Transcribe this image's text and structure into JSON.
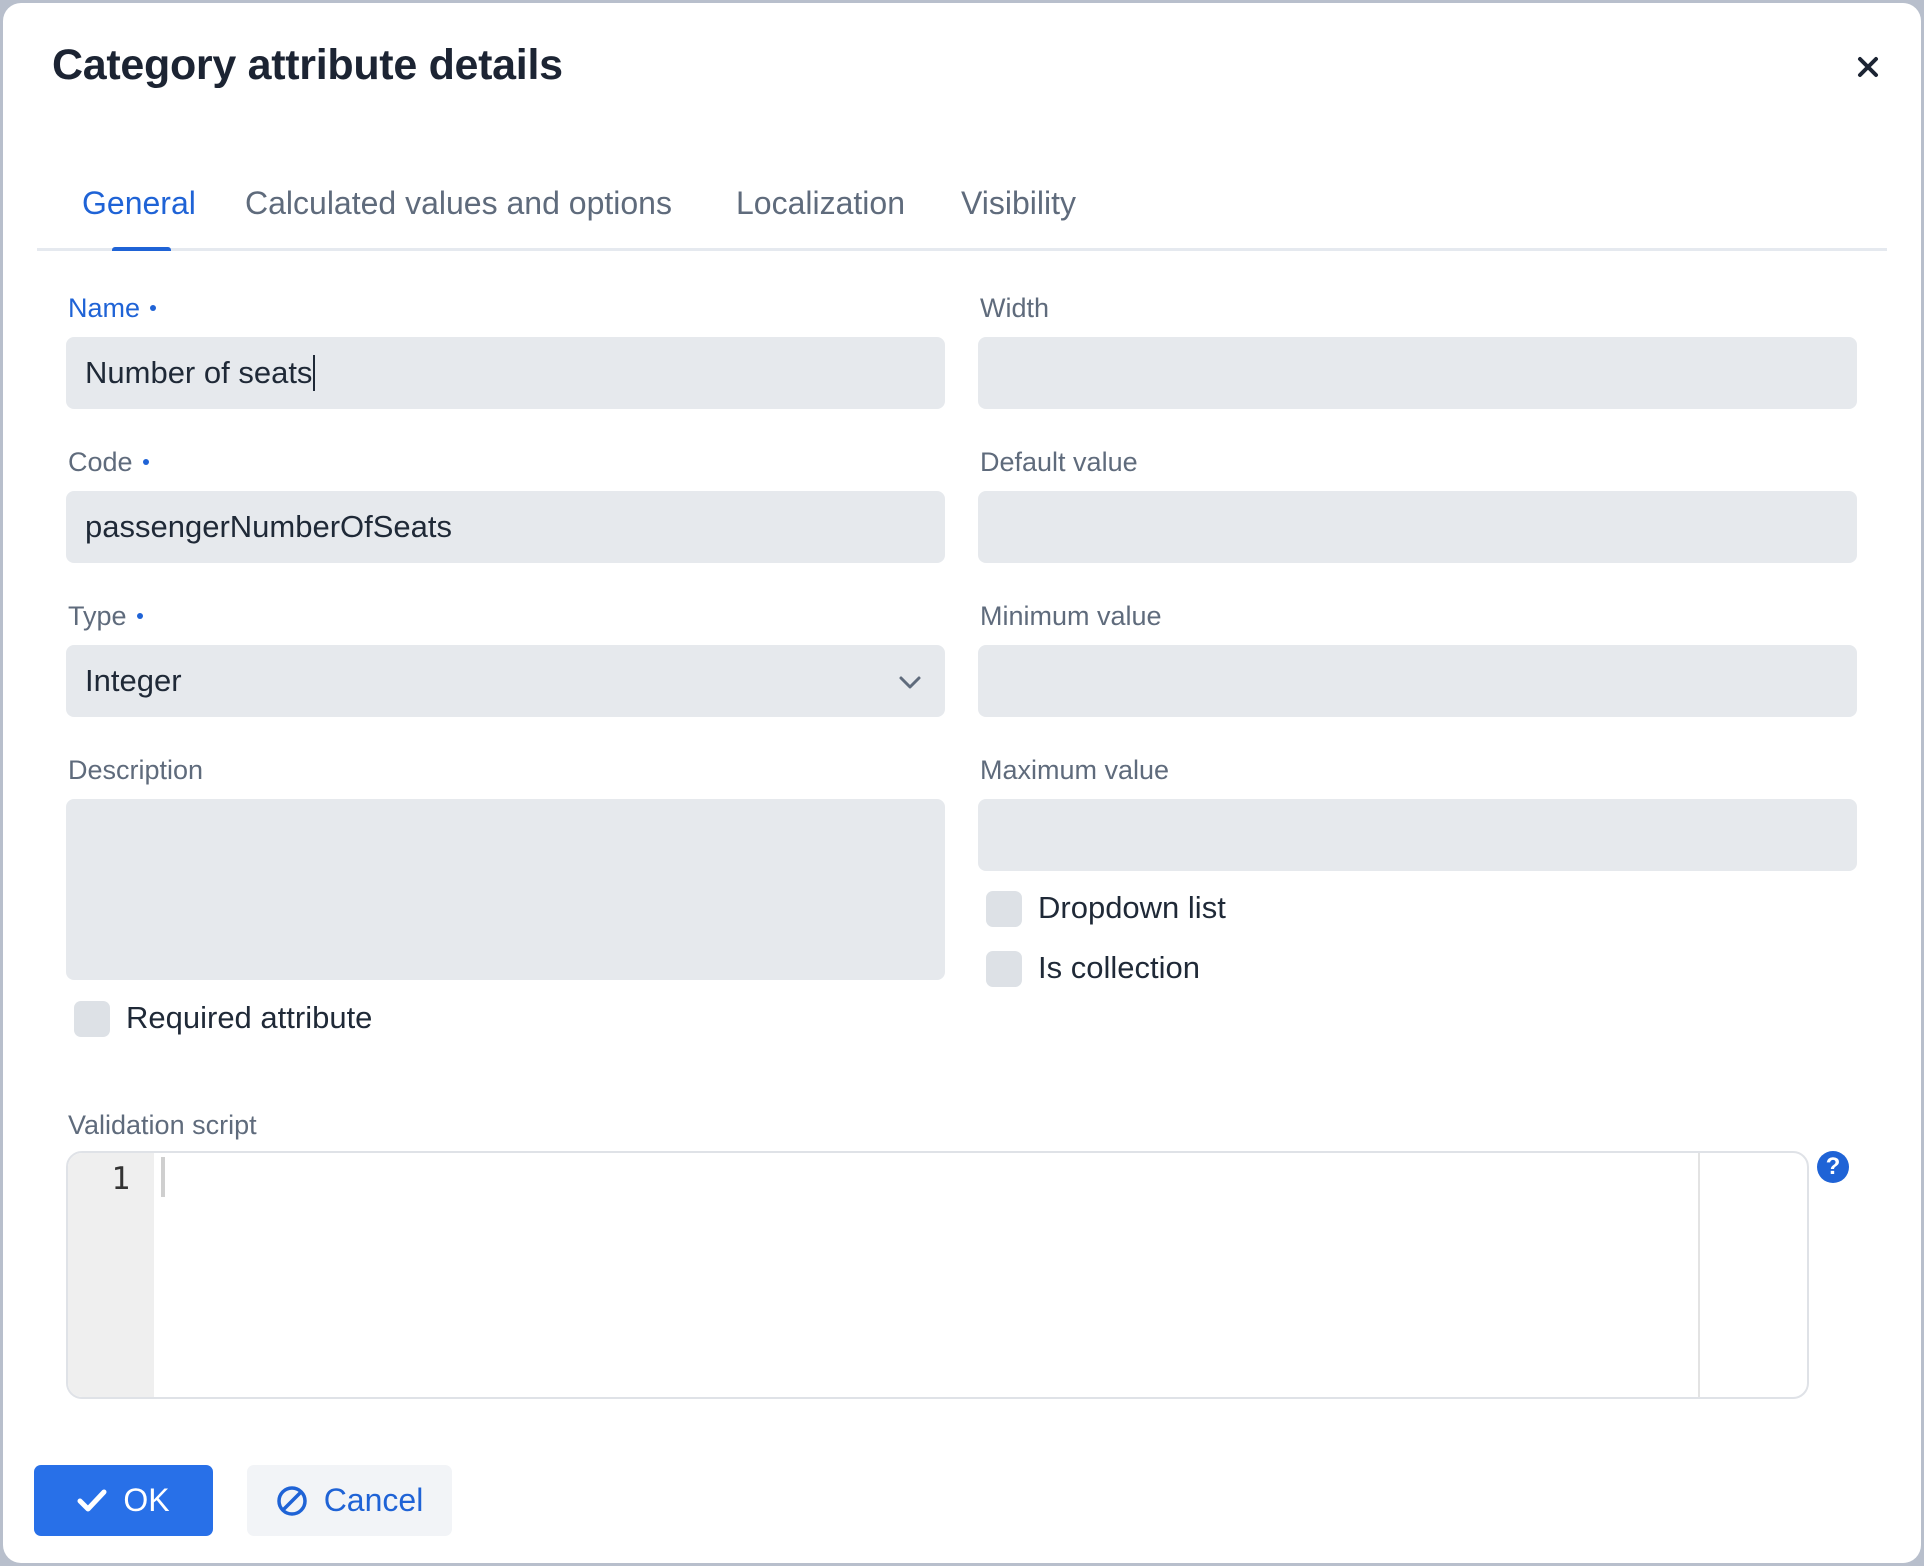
{
  "dialog": {
    "title": "Category attribute details",
    "close_icon": "close-icon"
  },
  "tabs": [
    {
      "label": "General",
      "active": true
    },
    {
      "label": "Calculated values and options",
      "active": false
    },
    {
      "label": "Localization",
      "active": false
    },
    {
      "label": "Visibility",
      "active": false
    }
  ],
  "form": {
    "name": {
      "label": "Name",
      "required": true,
      "value": "Number of seats"
    },
    "code": {
      "label": "Code",
      "required": true,
      "value": "passengerNumberOfSeats"
    },
    "type": {
      "label": "Type",
      "required": true,
      "value": "Integer"
    },
    "description": {
      "label": "Description",
      "value": ""
    },
    "required_attribute": {
      "label": "Required attribute",
      "checked": false
    },
    "width": {
      "label": "Width",
      "value": ""
    },
    "default_value": {
      "label": "Default value",
      "value": ""
    },
    "minimum_value": {
      "label": "Minimum value",
      "value": ""
    },
    "maximum_value": {
      "label": "Maximum value",
      "value": ""
    },
    "dropdown_list": {
      "label": "Dropdown list",
      "checked": false
    },
    "is_collection": {
      "label": "Is collection",
      "checked": false
    },
    "validation_script": {
      "label": "Validation script",
      "line_number": "1",
      "value": "",
      "help_icon": "?"
    }
  },
  "buttons": {
    "ok": "OK",
    "cancel": "Cancel"
  },
  "colors": {
    "accent": "#1f63d6",
    "primary_button": "#2870e8",
    "input_bg": "#e6e9ed"
  }
}
